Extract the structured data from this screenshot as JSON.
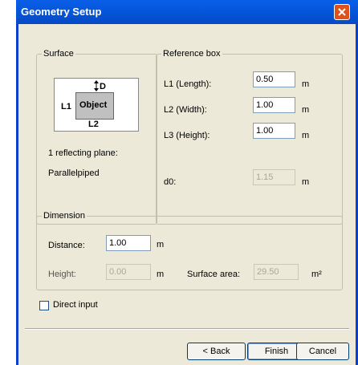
{
  "window": {
    "title": "Geometry Setup",
    "close_icon": "close-x-icon"
  },
  "surface": {
    "group_label": "Surface",
    "diagram": {
      "d_label": "D",
      "l1_label": "L1",
      "object_label": "Object",
      "l2_label": "L2"
    },
    "reflecting_text": "1 reflecting plane:",
    "shape_text": "Parallelpiped"
  },
  "reference_box": {
    "group_label": "Reference box",
    "l1_label": "L1 (Length):",
    "l1_value": "0.50",
    "l2_label": "L2 (Width):",
    "l2_value": "1.00",
    "l3_label": "L3 (Height):",
    "l3_value": "1.00",
    "d0_label": "d0:",
    "d0_value": "1.15",
    "unit": "m"
  },
  "dimension": {
    "group_label": "Dimension",
    "distance_label": "Distance:",
    "distance_value": "1.00",
    "height_label": "Height:",
    "height_value": "0.00",
    "surface_area_label": "Surface area:",
    "surface_area_value": "29.50",
    "unit": "m",
    "area_unit": "m²"
  },
  "direct_input": {
    "label": "Direct input",
    "checked": false
  },
  "buttons": {
    "back": "< Back",
    "finish": "Finish",
    "cancel": "Cancel"
  },
  "colors": {
    "titlebar": "#0454d8",
    "close": "#e0521b",
    "dialog_bg": "#ece9d8"
  }
}
